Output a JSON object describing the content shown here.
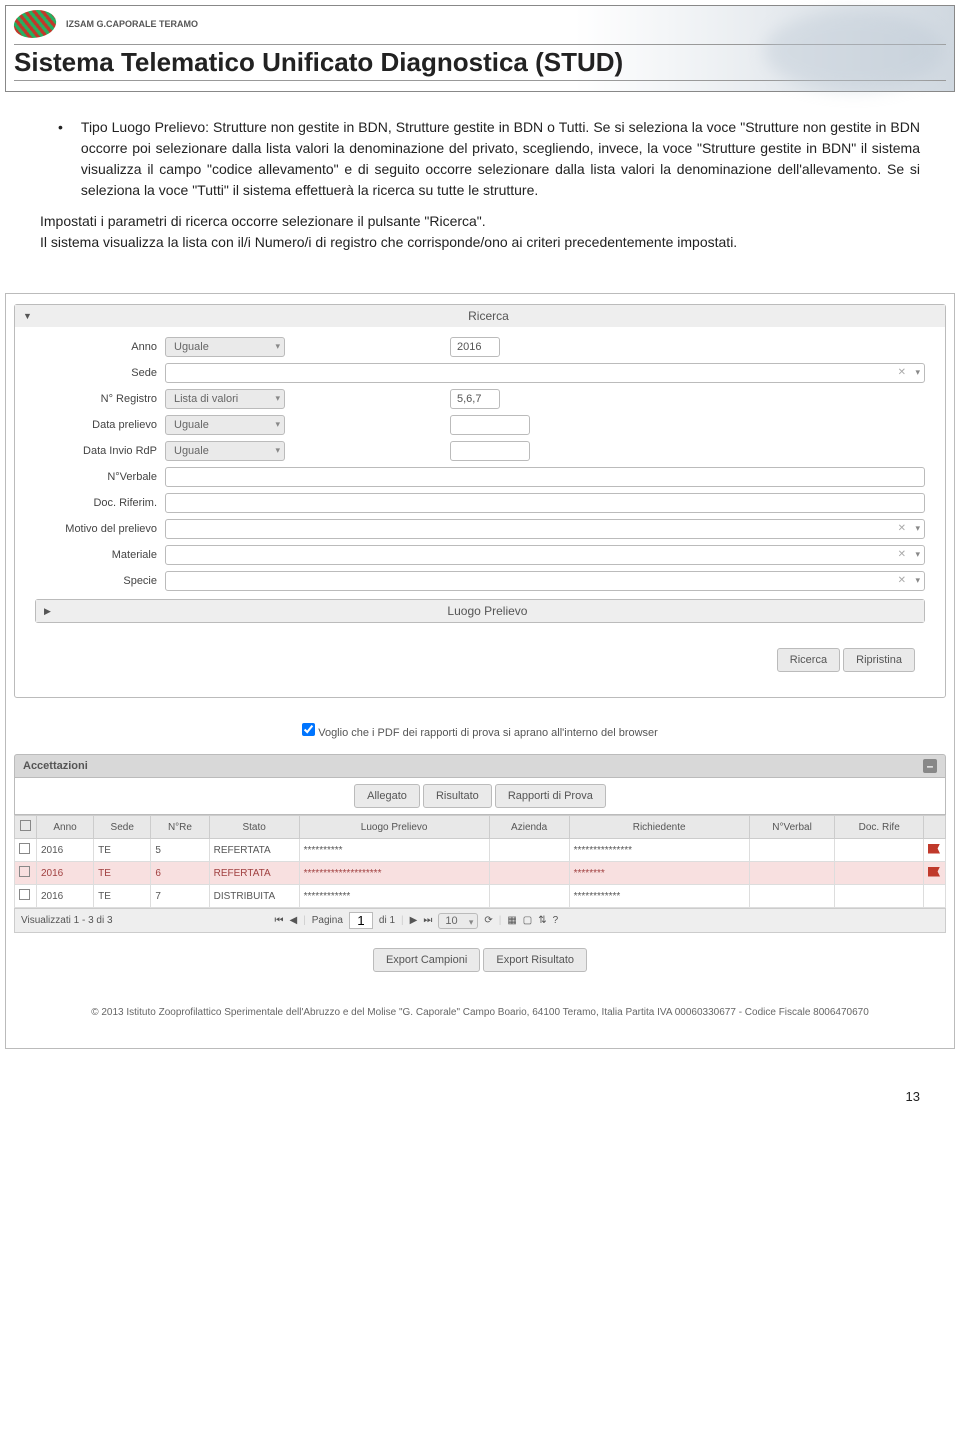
{
  "header": {
    "org": "IZSAM G.CAPORALE TERAMO",
    "title": "Sistema Telematico Unificato Diagnostica (STUD)"
  },
  "body": {
    "bullet": "Tipo Luogo Prelievo: Strutture non gestite in BDN, Strutture gestite in BDN o Tutti. Se si seleziona la voce \"Strutture non gestite in BDN occorre poi selezionare dalla lista valori la denominazione del privato, scegliendo, invece, la voce \"Strutture gestite in BDN\" il sistema visualizza il campo \"codice allevamento\" e di seguito occorre selezionare dalla lista valori la denominazione dell'allevamento. Se si seleziona la voce \"Tutti\" il sistema effettuerà la ricerca su tutte le strutture.",
    "p1": "Impostati i parametri di ricerca occorre selezionare il pulsante \"Ricerca\".",
    "p2": "Il sistema visualizza la lista con il/i Numero/i di registro che corrisponde/ono ai criteri precedentemente impostati."
  },
  "search": {
    "panel_title": "Ricerca",
    "labels": {
      "anno": "Anno",
      "sede": "Sede",
      "nreg": "N° Registro",
      "datap": "Data prelievo",
      "datai": "Data Invio RdP",
      "nverb": "N°Verbale",
      "doc": "Doc. Riferim.",
      "motivo": "Motivo del prelievo",
      "materiale": "Materiale",
      "specie": "Specie"
    },
    "ops": {
      "uguale": "Uguale",
      "lista": "Lista di valori"
    },
    "vals": {
      "anno": "2016",
      "nreg": "5,6,7"
    },
    "luogo_title": "Luogo Prelievo",
    "btn_ricerca": "Ricerca",
    "btn_ripristina": "Ripristina"
  },
  "pdf_check": "Voglio che i PDF dei rapporti di prova si aprano all'interno del browser",
  "grid": {
    "title": "Accettazioni",
    "tb": {
      "allegato": "Allegato",
      "risultato": "Risultato",
      "rapporti": "Rapporti di Prova"
    },
    "cols": {
      "anno": "Anno",
      "sede": "Sede",
      "nreg": "N°Re",
      "stato": "Stato",
      "luogo": "Luogo Prelievo",
      "azienda": "Azienda",
      "rich": "Richiedente",
      "nverb": "N°Verbal",
      "doc": "Doc. Rife"
    },
    "rows": [
      {
        "anno": "2016",
        "sede": "TE",
        "nreg": "5",
        "stato": "REFERTATA",
        "luogo": "**********",
        "rich": "***************",
        "flag": true
      },
      {
        "anno": "2016",
        "sede": "TE",
        "nreg": "6",
        "stato": "REFERTATA",
        "luogo": "********************",
        "rich": "********",
        "flag": true,
        "selected": true
      },
      {
        "anno": "2016",
        "sede": "TE",
        "nreg": "7",
        "stato": "DISTRIBUITA",
        "luogo": "************",
        "rich": "************",
        "flag": false
      }
    ],
    "pager": {
      "vis": "Visualizzati 1 - 3 di 3",
      "pagina": "Pagina",
      "di": "di 1",
      "cur": "1",
      "pp": "10"
    },
    "export1": "Export Campioni",
    "export2": "Export Risultato"
  },
  "footer": "© 2013 Istituto Zooprofilattico Sperimentale dell'Abruzzo e del Molise \"G. Caporale\" Campo Boario, 64100 Teramo, Italia Partita IVA 00060330677 - Codice Fiscale 8006470670",
  "page_num": "13"
}
